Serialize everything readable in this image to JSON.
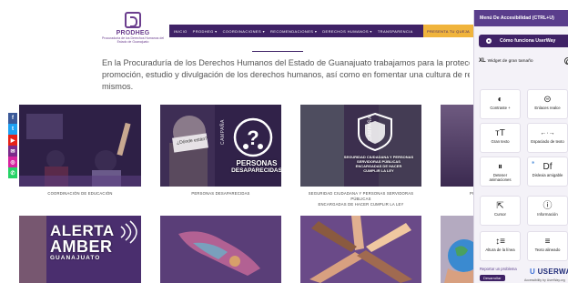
{
  "header": {
    "logo_name": "PRODHEG",
    "logo_sub": "Procuraduría de los Derechos Humanos del Estado de Guanajuato",
    "nav": [
      "INICIO",
      "PRODHEG ▾",
      "COORDINACIONES ▾",
      "RECOMENDACIONES ▾",
      "DERECHOS HUMANOS ▾",
      "TRANSPARENCIA"
    ],
    "cta": "PRESENTA TU QUEJA"
  },
  "intro": {
    "line1": "En la Procuraduría de los Derechos Humanos del Estado de Guanajuato trabajamos para la protección, defensa,",
    "line2": "promoción, estudio y divulgación de los derechos humanos, así como en fomentar una cultura de respeto a los",
    "line3": "mismos."
  },
  "social": [
    {
      "icon": "facebook-icon",
      "glyph": "f",
      "color": "#3b5998"
    },
    {
      "icon": "twitter-icon",
      "glyph": "t",
      "color": "#1da1f2"
    },
    {
      "icon": "youtube-icon",
      "glyph": "▶",
      "color": "#e62117"
    },
    {
      "icon": "email-icon",
      "glyph": "✉",
      "color": "#7a2a8a"
    },
    {
      "icon": "instagram-icon",
      "glyph": "◎",
      "color": "#d6249f"
    },
    {
      "icon": "whatsapp-icon",
      "glyph": "✆",
      "color": "#25d366"
    }
  ],
  "cards": {
    "education": {
      "caption": "COORDINACIÓN DE EDUCACIÓN"
    },
    "missing": {
      "caption": "PERSONAS DESAPARECIDAS",
      "overlay_line1": "PERSONAS",
      "overlay_line2": "DESAPARECIDAS",
      "vertical_tag": "CAMPAÑA",
      "sign_text": "¿Dónde están?"
    },
    "security": {
      "caption_line1": "SEGURIDAD CIUDADANA Y PERSONAS SERVIDORAS PÚBLICAS",
      "caption_line2": "ENCARGADAS DE HACER CUMPLIR LA LEY",
      "overlay_line1": "SEGURIDAD CIUDADANA Y PERSONAS",
      "overlay_line2": "SERVIDORAS PÚBLICAS",
      "overlay_line3": "ENCARGADAS DE HACER",
      "overlay_line4": "CUMPLIR LA LEY",
      "vertical_tag": "CAMPAÑA"
    },
    "partial": {
      "caption": "PU"
    },
    "amber": {
      "line1": "ALERTA",
      "line2": "AMBER",
      "line3": "GUANAJUATO"
    }
  },
  "accessibility": {
    "title": "Menú De Accesibilidad (CTRL+U)",
    "howto": "Cómo funciona UserWay",
    "xl_prefix": "XL",
    "xl_label": "Widget de gran tamaño",
    "tiles": [
      {
        "icon": "contrast-icon",
        "glyph": "◐",
        "label": "Contraste +"
      },
      {
        "icon": "link-icon",
        "glyph": "⊝",
        "label": "Enlaces realce"
      },
      {
        "icon": "text-size-icon",
        "glyph": "тT",
        "label": "Gran texto"
      },
      {
        "icon": "text-spacing-icon",
        "glyph": "←·→",
        "label": "Espaciado de texto"
      },
      {
        "icon": "pause-animation-icon",
        "glyph": "⏸",
        "label": "Detener animaciones"
      },
      {
        "icon": "dyslexia-icon",
        "glyph": "Df",
        "label": "Dislexia amigable"
      },
      {
        "icon": "cursor-icon",
        "glyph": "⇱",
        "label": "Cursor"
      },
      {
        "icon": "info-icon",
        "glyph": "ⓘ",
        "label": "Información"
      },
      {
        "icon": "line-height-icon",
        "glyph": "↕≡",
        "label": "Altura de la línea"
      },
      {
        "icon": "text-align-icon",
        "glyph": "≡",
        "label": "Texto alineado"
      }
    ],
    "report_text": "Reportar un problema",
    "report_button": "Desarrollar",
    "brand_a": "USER",
    "brand_b": "WAY",
    "brand_sub": "Accessibility by UserWay.org"
  }
}
